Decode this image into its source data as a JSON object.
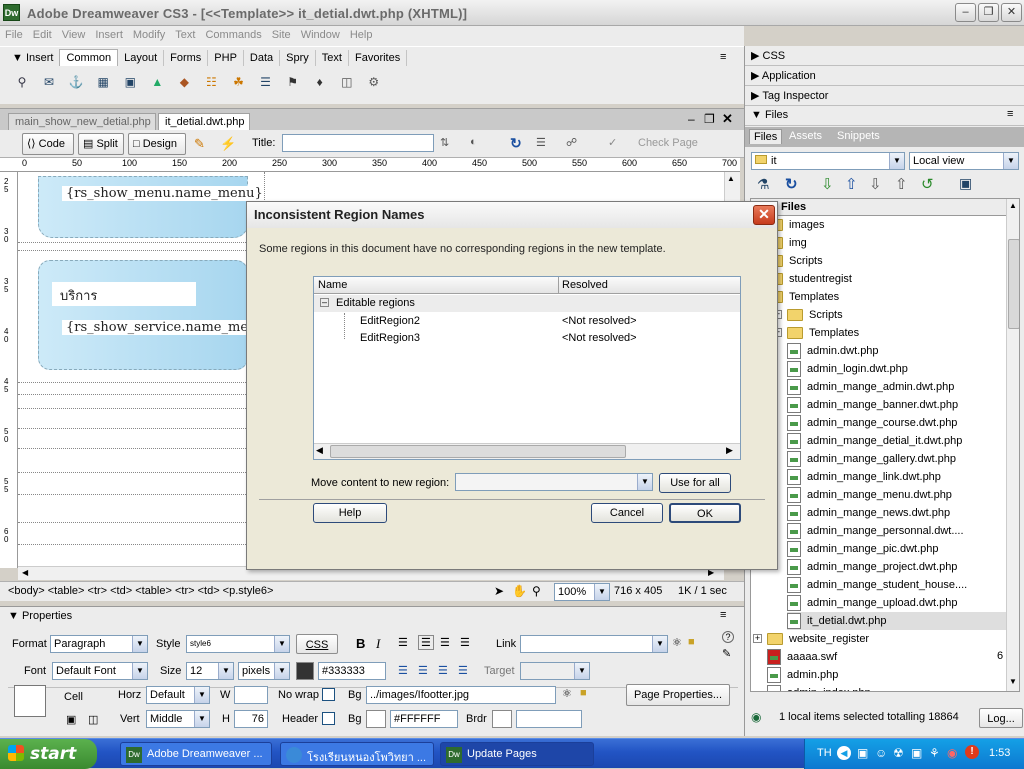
{
  "app": {
    "icon_text": "Dw",
    "title": "Adobe Dreamweaver CS3 - [<<Template>> it_detial.dwt.php (XHTML)]",
    "menu": [
      "File",
      "Edit",
      "View",
      "Insert",
      "Modify",
      "Text",
      "Commands",
      "Site",
      "Window",
      "Help"
    ]
  },
  "insertbar": {
    "label": "Insert",
    "tabs": [
      "Common",
      "Layout",
      "Forms",
      "PHP",
      "Data",
      "Spry",
      "Text",
      "Favorites"
    ]
  },
  "document": {
    "tabs": [
      "main_show_new_detial.php",
      "it_detial.dwt.php"
    ],
    "view_buttons": {
      "code": "Code",
      "split": "Split",
      "design": "Design"
    },
    "title_label": "Title:",
    "check_page": "Check Page",
    "ruler_ticks": [
      "0",
      "50",
      "100",
      "150",
      "200",
      "250",
      "300",
      "350",
      "400",
      "450",
      "500",
      "550",
      "600",
      "650",
      "700"
    ],
    "vruler_ticks": [
      "2\n5",
      "3\n0",
      "3\n5",
      "4\n0",
      "4\n5",
      "5\n0",
      "5\n5",
      "6\n0"
    ],
    "content": {
      "field1": "{rs_show_menu.name_menu}",
      "heading": "บริการ",
      "field2": "{rs_show_service.name_menu}"
    },
    "tag_path": "<body> <table> <tr> <td> <table> <tr> <td> <p.style6>",
    "zoom": "100%",
    "size": "716 x 405",
    "filesize": "1K / 1 sec"
  },
  "properties": {
    "title": "Properties",
    "format_label": "Format",
    "format_value": "Paragraph",
    "style_label": "Style",
    "style_value": "style6",
    "css_btn": "CSS",
    "bold": "B",
    "italic": "I",
    "link_label": "Link",
    "font_label": "Font",
    "font_value": "Default Font",
    "size_label": "Size",
    "size_value": "12",
    "unit_value": "pixels",
    "color_value": "#333333",
    "target_label": "Target",
    "cell_label": "Cell",
    "horz_label": "Horz",
    "horz_value": "Default",
    "w_label": "W",
    "nowrap_label": "No wrap",
    "bg_label": "Bg",
    "bg_value": "../images/Ifootter.jpg",
    "page_props": "Page Properties...",
    "vert_label": "Vert",
    "vert_value": "Middle",
    "h_label": "H",
    "h_value": "76",
    "header_label": "Header",
    "bg2_label": "Bg",
    "bg2_value": "#FFFFFF",
    "brdr_label": "Brdr"
  },
  "panels": {
    "css": "CSS",
    "application": "Application",
    "tag_inspector": "Tag Inspector",
    "files": "Files",
    "file_tabs": [
      "Files",
      "Assets",
      "Snippets"
    ],
    "site_value": "it",
    "view_value": "Local view",
    "tree_header": "Files",
    "tree": [
      {
        "name": "images",
        "type": "folder",
        "indent": 0
      },
      {
        "name": "img",
        "type": "folder",
        "indent": 0
      },
      {
        "name": "Scripts",
        "type": "folder",
        "indent": 0
      },
      {
        "name": "studentregist",
        "type": "folder",
        "indent": 0
      },
      {
        "name": "Templates",
        "type": "folder",
        "indent": 0
      },
      {
        "name": "Scripts",
        "type": "folder",
        "indent": 1
      },
      {
        "name": "Templates",
        "type": "folder",
        "indent": 1
      },
      {
        "name": "admin.dwt.php",
        "type": "file",
        "indent": 1
      },
      {
        "name": "admin_login.dwt.php",
        "type": "file",
        "indent": 1
      },
      {
        "name": "admin_mange_admin.dwt.php",
        "type": "file",
        "indent": 1
      },
      {
        "name": "admin_mange_banner.dwt.php",
        "type": "file",
        "indent": 1
      },
      {
        "name": "admin_mange_course.dwt.php",
        "type": "file",
        "indent": 1
      },
      {
        "name": "admin_mange_detial_it.dwt.php",
        "type": "file",
        "indent": 1
      },
      {
        "name": "admin_mange_gallery.dwt.php",
        "type": "file",
        "indent": 1
      },
      {
        "name": "admin_mange_link.dwt.php",
        "type": "file",
        "indent": 1
      },
      {
        "name": "admin_mange_menu.dwt.php",
        "type": "file",
        "indent": 1
      },
      {
        "name": "admin_mange_news.dwt.php",
        "type": "file",
        "indent": 1
      },
      {
        "name": "admin_mange_personnal.dwt....",
        "type": "file",
        "indent": 1
      },
      {
        "name": "admin_mange_pic.dwt.php",
        "type": "file",
        "indent": 1
      },
      {
        "name": "admin_mange_project.dwt.php",
        "type": "file",
        "indent": 1
      },
      {
        "name": "admin_mange_student_house....",
        "type": "file",
        "indent": 1
      },
      {
        "name": "admin_mange_upload.dwt.php",
        "type": "file",
        "indent": 1
      },
      {
        "name": "it_detial.dwt.php",
        "type": "file",
        "indent": 1
      },
      {
        "name": "website_register",
        "type": "folder",
        "indent": 0
      },
      {
        "name": "aaaaa.swf",
        "type": "swf",
        "indent": 0
      },
      {
        "name": "admin.php",
        "type": "file",
        "indent": 0
      },
      {
        "name": "admin_index.php",
        "type": "file",
        "indent": 0
      }
    ],
    "swf_size": "6",
    "status": "1 local items selected totalling 18864 byt",
    "log_btn": "Log..."
  },
  "dialog": {
    "title": "Inconsistent Region Names",
    "message": "Some regions in this document have no corresponding regions in the new template.",
    "col_name": "Name",
    "col_resolved": "Resolved",
    "group": "Editable regions",
    "rows": [
      {
        "name": "EditRegion2",
        "resolved": "<Not resolved>"
      },
      {
        "name": "EditRegion3",
        "resolved": "<Not resolved>"
      }
    ],
    "move_label": "Move content to new region:",
    "use_for_all": "Use for all",
    "help": "Help",
    "cancel": "Cancel",
    "ok": "OK"
  },
  "taskbar": {
    "start": "start",
    "tasks": [
      "Adobe Dreamweaver ...",
      "โรงเรียนหนองโพวิทยา ...",
      "Update Pages"
    ],
    "lang": "TH",
    "clock": "1:53"
  }
}
